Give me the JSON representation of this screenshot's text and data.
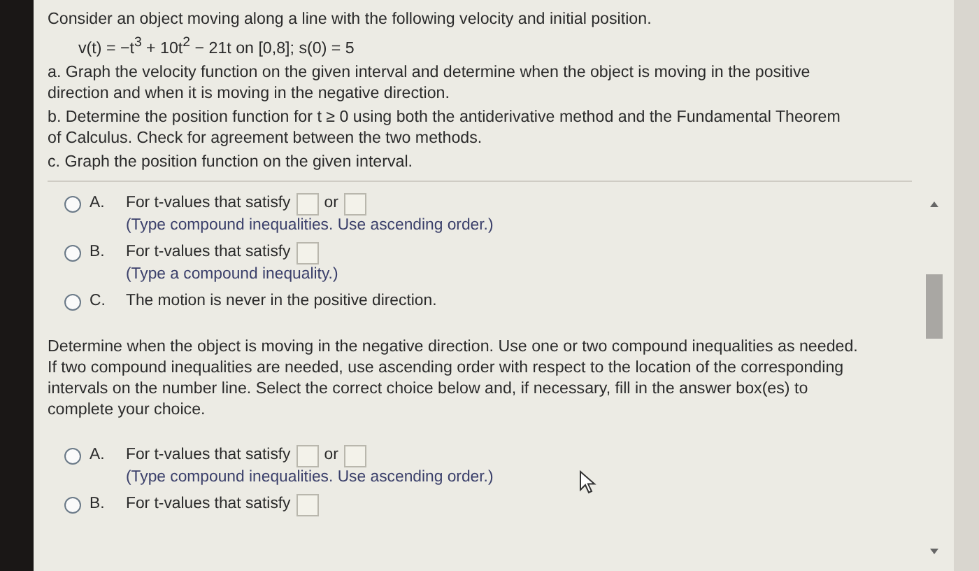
{
  "problem": {
    "intro": "Consider an object moving along a line with the following velocity and initial position.",
    "equation": "v(t) = −t$^{3}$ + 10t$^{2}$ − 21t on [0,8]; s(0) = 5",
    "parts": [
      "a. Graph the velocity function on the given interval and determine when the object is moving in the positive direction and when it is moving in the negative direction.",
      "b. Determine the position function for t ≥ 0 using both the antiderivative method and the Fundamental Theorem of Calculus. Check for agreement between the two methods.",
      "c. Graph the position function on the given interval."
    ]
  },
  "question_1": {
    "choices": [
      {
        "letter": "A.",
        "text": "For t-values that satisfy",
        "kind": "two-boxes",
        "connector": "or",
        "hint": "(Type compound inequalities. Use ascending order.)",
        "selected": false
      },
      {
        "letter": "B.",
        "text": "For t-values that satisfy",
        "kind": "one-box",
        "hint": "(Type a compound inequality.)",
        "selected": false
      },
      {
        "letter": "C.",
        "text": "The motion is never in the positive direction.",
        "kind": "plain",
        "selected": false
      }
    ]
  },
  "question_2": {
    "prompt": "Determine when the object is moving in the negative direction. Use one or two compound inequalities as needed. If two compound inequalities are needed, use ascending order with respect to the location of the corresponding intervals on the number line. Select the correct choice below and, if necessary, fill in the answer box(es) to complete your choice.",
    "choices": [
      {
        "letter": "A.",
        "text": "For t-values that satisfy",
        "kind": "two-boxes",
        "connector": "or",
        "hint": "(Type compound inequalities. Use ascending order.)",
        "selected": false
      },
      {
        "letter": "B.",
        "text": "For t-values that satisfy",
        "kind": "one-box",
        "selected": false
      }
    ]
  }
}
